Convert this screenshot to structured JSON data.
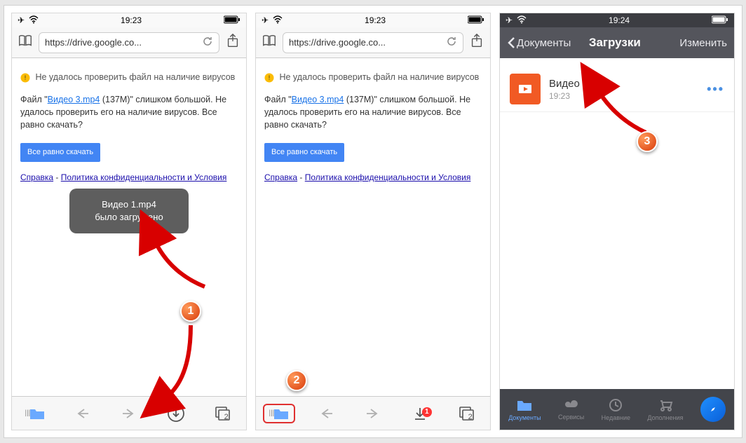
{
  "screen1": {
    "statusbar": {
      "time": "19:23"
    },
    "url": "https://drive.google.co...",
    "warning_title": "Не удалось проверить файл на наличие вирусов",
    "body_prefix": "Файл \"",
    "body_filename": "Видео 3.mp4",
    "body_size": " (137M)\" слишком большой. Не удалось проверить его на наличие вирусов. Все равно скачать?",
    "download_btn": "Все равно скачать",
    "help_link": "Справка",
    "link_sep": " - ",
    "privacy_link": "Политика конфиденциальности и Условия",
    "toast_line1": "Видео 1.mp4",
    "toast_line2": "было загружено",
    "tabs_count": "2",
    "step": "1"
  },
  "screen2": {
    "statusbar": {
      "time": "19:23"
    },
    "url": "https://drive.google.co...",
    "warning_title": "Не удалось проверить файл на наличие вирусов",
    "body_prefix": "Файл \"",
    "body_filename": "Видео 3.mp4",
    "body_size": " (137M)\" слишком большой. Не удалось проверить его на наличие вирусов. Все равно скачать?",
    "download_btn": "Все равно скачать",
    "help_link": "Справка",
    "link_sep": " - ",
    "privacy_link": "Политика конфиденциальности и Условия",
    "tabs_count": "2",
    "dl_badge": "1",
    "step": "2"
  },
  "screen3": {
    "statusbar": {
      "time": "19:24"
    },
    "back_label": "Документы",
    "title": "Загрузки",
    "edit": "Изменить",
    "file": {
      "name": "Видео 1",
      "time": "19:23"
    },
    "tabs": {
      "documents": "Документы",
      "services": "Сервисы",
      "recent": "Недавние",
      "addons": "Дополнения"
    },
    "step": "3"
  }
}
